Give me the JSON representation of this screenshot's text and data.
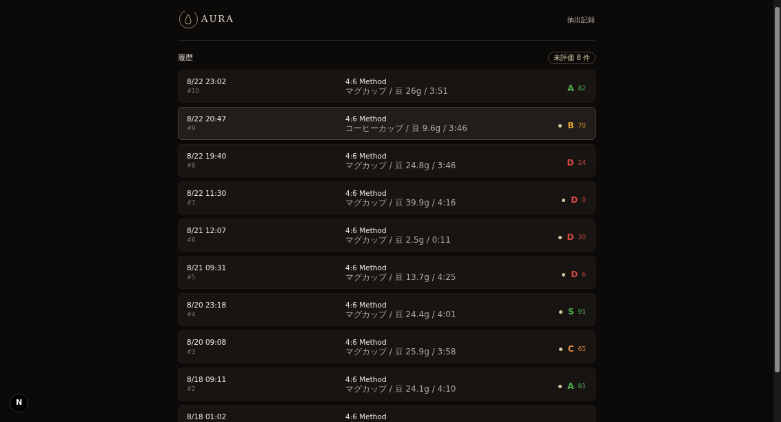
{
  "header": {
    "logo_text": "AURA",
    "nav_link": "抽出記録"
  },
  "history": {
    "title": "履歴",
    "unrated_badge": "未評価 8 件",
    "rows": [
      {
        "datetime": "8/22 23:02",
        "number": "#10",
        "method": "4:6 Method",
        "details": "マグカップ / 豆 26g / 3:51",
        "unrated": false,
        "grade": "A",
        "score": "82",
        "color": "#4caf50",
        "selected": false
      },
      {
        "datetime": "8/22 20:47",
        "number": "#9",
        "method": "4:6 Method",
        "details": "コーヒーカップ / 豆 9.6g / 3:46",
        "unrated": true,
        "grade": "B",
        "score": "70",
        "color": "#e0a030",
        "selected": true
      },
      {
        "datetime": "8/22 19:40",
        "number": "#8",
        "method": "4:6 Method",
        "details": "マグカップ / 豆 24.8g / 3:46",
        "unrated": false,
        "grade": "D",
        "score": "24",
        "color": "#d24a43",
        "selected": false
      },
      {
        "datetime": "8/22 11:30",
        "number": "#7",
        "method": "4:6 Method",
        "details": "マグカップ / 豆 39.9g / 4:16",
        "unrated": true,
        "grade": "D",
        "score": "0",
        "color": "#d24a43",
        "selected": false
      },
      {
        "datetime": "8/21 12:07",
        "number": "#6",
        "method": "4:6 Method",
        "details": "マグカップ / 豆 2.5g / 0:11",
        "unrated": true,
        "grade": "D",
        "score": "30",
        "color": "#d24a43",
        "selected": false
      },
      {
        "datetime": "8/21 09:31",
        "number": "#5",
        "method": "4:6 Method",
        "details": "マグカップ / 豆 13.7g / 4:25",
        "unrated": true,
        "grade": "D",
        "score": "6",
        "color": "#d24a43",
        "selected": false
      },
      {
        "datetime": "8/20 23:18",
        "number": "#4",
        "method": "4:6 Method",
        "details": "マグカップ / 豆 24.4g / 4:01",
        "unrated": true,
        "grade": "S",
        "score": "91",
        "color": "#4caf50",
        "selected": false
      },
      {
        "datetime": "8/20 09:08",
        "number": "#3",
        "method": "4:6 Method",
        "details": "マグカップ / 豆 25.9g / 3:58",
        "unrated": true,
        "grade": "C",
        "score": "65",
        "color": "#e08a3c",
        "selected": false
      },
      {
        "datetime": "8/18 09:11",
        "number": "#2",
        "method": "4:6 Method",
        "details": "マグカップ / 豆 24.1g / 4:10",
        "unrated": true,
        "grade": "A",
        "score": "81",
        "color": "#4caf50",
        "selected": false
      },
      {
        "datetime": "8/18 01:02",
        "method": "4:6 Method",
        "selected": false
      }
    ]
  },
  "dev_badge": "N"
}
